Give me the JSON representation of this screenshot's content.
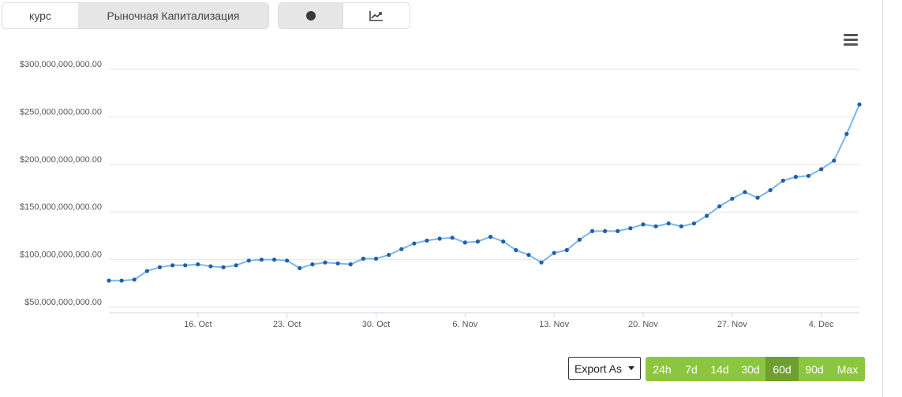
{
  "metric_tabs": [
    {
      "label": "курс",
      "active": false
    },
    {
      "label": "Рыночная Капитализация",
      "active": true
    }
  ],
  "type_tabs": [
    {
      "icon": "dot-icon",
      "active": true
    },
    {
      "icon": "line-chart-icon",
      "active": false
    }
  ],
  "menu_icon": "hamburger-menu-icon",
  "export_label": "Export As",
  "ranges": [
    {
      "label": "24h",
      "active": false
    },
    {
      "label": "7d",
      "active": false
    },
    {
      "label": "14d",
      "active": false
    },
    {
      "label": "30d",
      "active": false
    },
    {
      "label": "60d",
      "active": true
    },
    {
      "label": "90d",
      "active": false
    },
    {
      "label": "Max",
      "active": false
    }
  ],
  "colors": {
    "line": "#7cb5ec",
    "marker": "#1f5fa5",
    "grid": "#e6e6e6",
    "range_button": "#8cc63f",
    "range_button_active": "#6f9e31"
  },
  "chart_data": {
    "type": "line",
    "title": "",
    "xlabel": "",
    "ylabel": "",
    "ylim": [
      50000000000,
      300000000000
    ],
    "y_ticks": [
      50000000000,
      100000000000,
      150000000000,
      200000000000,
      250000000000,
      300000000000
    ],
    "y_tick_labels": [
      "$50,000,000,000.00",
      "$100,000,000,000.00",
      "$150,000,000,000.00",
      "$200,000,000,000.00",
      "$250,000,000,000.00",
      "$300,000,000,000.00"
    ],
    "x_ticks": [
      "2017-10-16",
      "2017-10-23",
      "2017-10-30",
      "2017-11-06",
      "2017-11-13",
      "2017-11-20",
      "2017-11-27",
      "2017-12-04"
    ],
    "x_tick_labels": [
      "16. Oct",
      "23. Oct",
      "30. Oct",
      "6. Nov",
      "13. Nov",
      "20. Nov",
      "27. Nov",
      "4. Dec"
    ],
    "xlim": [
      "2017-10-09",
      "2017-12-07"
    ],
    "grid": true,
    "legend": false,
    "series": [
      {
        "x": [
          "2017-10-09",
          "2017-10-10",
          "2017-10-11",
          "2017-10-12",
          "2017-10-13",
          "2017-10-14",
          "2017-10-15",
          "2017-10-16",
          "2017-10-17",
          "2017-10-18",
          "2017-10-19",
          "2017-10-20",
          "2017-10-21",
          "2017-10-22",
          "2017-10-23",
          "2017-10-24",
          "2017-10-25",
          "2017-10-26",
          "2017-10-27",
          "2017-10-28",
          "2017-10-29",
          "2017-10-30",
          "2017-10-31",
          "2017-11-01",
          "2017-11-02",
          "2017-11-03",
          "2017-11-04",
          "2017-11-05",
          "2017-11-06",
          "2017-11-07",
          "2017-11-08",
          "2017-11-09",
          "2017-11-10",
          "2017-11-11",
          "2017-11-12",
          "2017-11-13",
          "2017-11-14",
          "2017-11-15",
          "2017-11-16",
          "2017-11-17",
          "2017-11-18",
          "2017-11-19",
          "2017-11-20",
          "2017-11-21",
          "2017-11-22",
          "2017-11-23",
          "2017-11-24",
          "2017-11-25",
          "2017-11-26",
          "2017-11-27",
          "2017-11-28",
          "2017-11-29",
          "2017-11-30",
          "2017-12-01",
          "2017-12-02",
          "2017-12-03",
          "2017-12-04",
          "2017-12-05",
          "2017-12-06",
          "2017-12-07"
        ],
        "values": [
          78000000000,
          78000000000,
          79000000000,
          88000000000,
          92000000000,
          94000000000,
          94000000000,
          95000000000,
          93000000000,
          92000000000,
          94000000000,
          99000000000,
          100000000000,
          100000000000,
          99000000000,
          91000000000,
          95000000000,
          97000000000,
          96000000000,
          95000000000,
          101000000000,
          101000000000,
          105000000000,
          111000000000,
          117000000000,
          120000000000,
          122000000000,
          123000000000,
          118000000000,
          119000000000,
          124000000000,
          119000000000,
          110000000000,
          105000000000,
          97000000000,
          107000000000,
          110000000000,
          121000000000,
          130000000000,
          130000000000,
          130000000000,
          133000000000,
          137000000000,
          135000000000,
          138000000000,
          135000000000,
          138000000000,
          146000000000,
          156000000000,
          164000000000,
          171000000000,
          165000000000,
          173000000000,
          183000000000,
          187000000000,
          188000000000,
          195000000000,
          204000000000,
          232000000000,
          263000000000
        ]
      }
    ]
  }
}
